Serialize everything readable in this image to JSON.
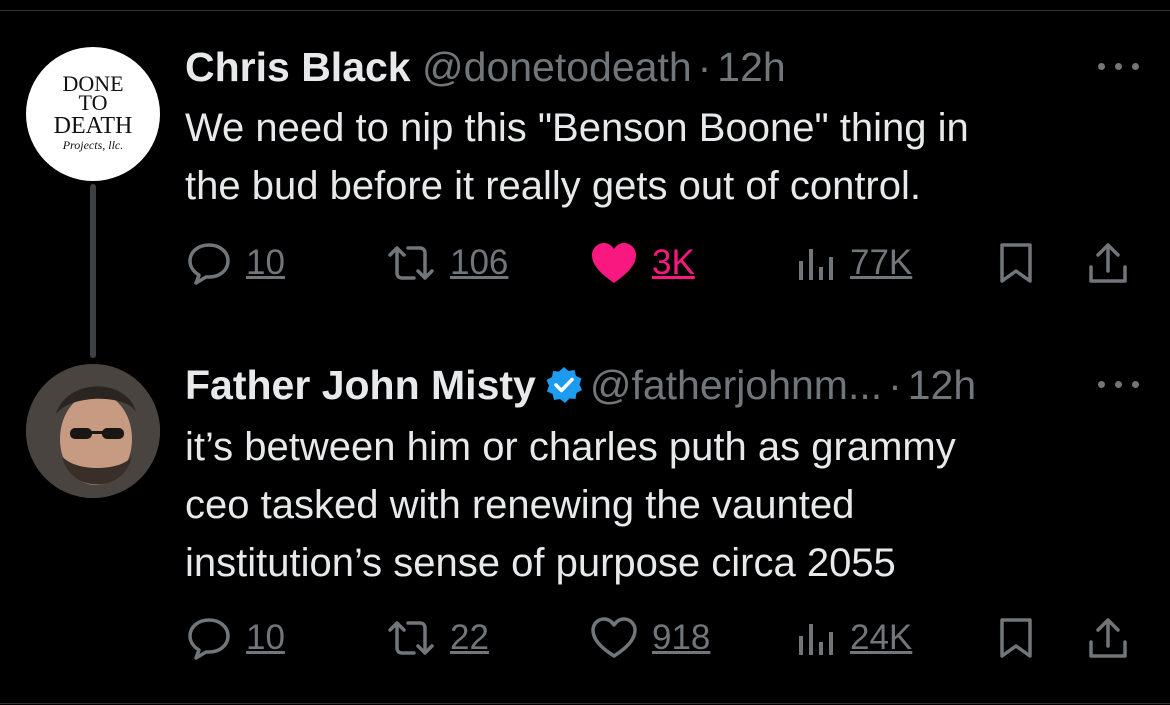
{
  "tweets": [
    {
      "author_name": "Chris Black",
      "handle": "@donetodeath",
      "separator": "·",
      "time": "12h",
      "avatar_text": [
        "DONE",
        "TO",
        "DEATH",
        "Projects, llc."
      ],
      "text_lines": [
        "We need to nip this \"Benson Boone\" thing in",
        "the bud before it really gets out of control."
      ],
      "replies": "10",
      "reposts": "106",
      "likes": "3K",
      "views": "77K",
      "liked": true
    },
    {
      "author_name": "Father John Misty",
      "verified": true,
      "handle": "@fatherjohnm...",
      "separator": "·",
      "time": "12h",
      "text_lines": [
        "it’s between him or charles puth as grammy",
        "ceo tasked with renewing the vaunted",
        "institution’s sense of purpose circa 2055"
      ],
      "replies": "10",
      "reposts": "22",
      "likes": "918",
      "views": "24K",
      "liked": false
    }
  ],
  "icons": {
    "reply": "reply-icon",
    "repost": "repost-icon",
    "like": "heart-icon",
    "views": "views-icon",
    "bookmark": "bookmark-icon",
    "share": "share-icon",
    "more": "more-icon",
    "verified": "verified-badge-icon"
  },
  "colors": {
    "background": "#000000",
    "text": "#e7e9ea",
    "muted": "#71767b",
    "like": "#f91880",
    "verified": "#1d9bf0"
  }
}
